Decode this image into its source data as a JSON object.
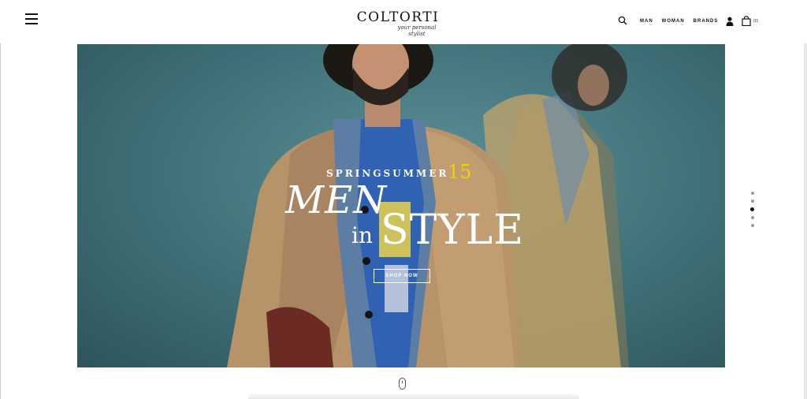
{
  "header": {
    "brand": "COLTORTI",
    "tagline": "your personal stylist",
    "nav": [
      {
        "label": "MAN"
      },
      {
        "label": "WOMAN"
      },
      {
        "label": "BRANDS"
      }
    ],
    "bag_count": "(0)",
    "icons": [
      "menu-icon",
      "search-icon",
      "user-icon",
      "shopping-bag-icon"
    ]
  },
  "hero": {
    "season": "SPRINGSUMMER",
    "season_year": "15",
    "headline_1": "MEN",
    "headline_in": "in",
    "headline_2": "STYLE",
    "cta": "SHOP NOW",
    "slides_total": 5,
    "active_slide": 3,
    "colors": {
      "backdrop": "#3f7077",
      "accent": "#f0d200"
    }
  },
  "footer": {
    "icons": [
      "scroll-mouse-icon"
    ]
  }
}
